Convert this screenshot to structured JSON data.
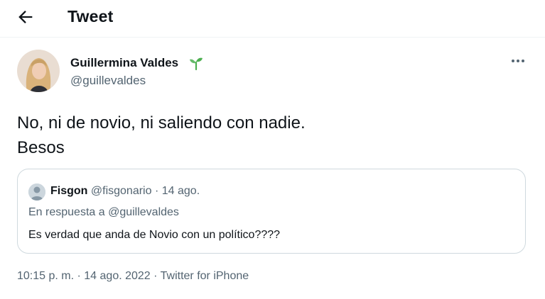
{
  "header": {
    "title": "Tweet",
    "back_icon": "arrow-left-icon"
  },
  "author": {
    "display_name": "Guillermina Valdes",
    "handle": "@guillevaldes",
    "name_emoji": "seedling-icon",
    "more_icon": "more-horizontal-icon"
  },
  "tweet": {
    "line1": "No, ni de novio, ni saliendo con nadie.",
    "line2": "Besos"
  },
  "quoted": {
    "name": "Fisgon",
    "handle": "@fisgonario",
    "separator": "·",
    "date": "14 ago.",
    "reply_prefix": "En respuesta a",
    "reply_to": "@guillevaldes",
    "text": "Es verdad que anda de Novio con un político????"
  },
  "footer": {
    "time": "10:15 p. m.",
    "separator": "·",
    "date": "14 ago. 2022",
    "source": "Twitter for iPhone"
  },
  "colors": {
    "text": "#0f1419",
    "secondary": "#536471",
    "border": "#cfd9de",
    "sprout": "#4caf50"
  }
}
